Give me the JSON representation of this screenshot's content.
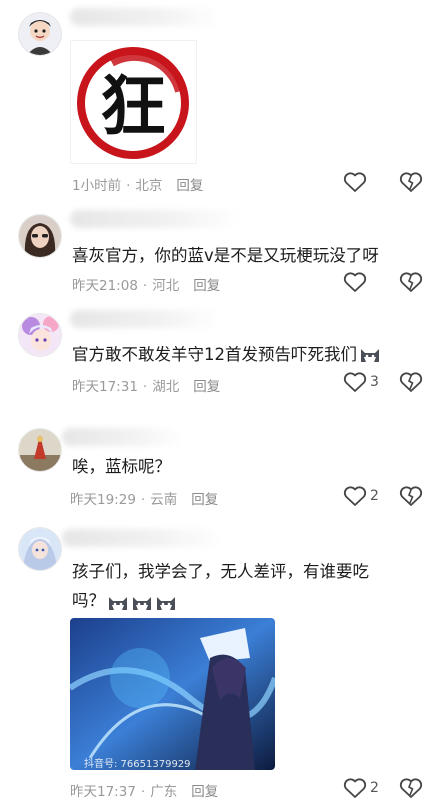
{
  "comments": [
    {
      "text": "",
      "time": "1小时前",
      "location": "北京",
      "reply_label": "回复",
      "likes": "",
      "sticker_char": "狂"
    },
    {
      "text": "喜灰官方，你的蓝v是不是又玩梗玩没了呀",
      "time": "昨天21:08",
      "location": "河北",
      "reply_label": "回复",
      "likes": ""
    },
    {
      "text": "官方敢不敢发羊守12首发预告吓死我们",
      "time": "昨天17:31",
      "location": "湖北",
      "reply_label": "回复",
      "likes": "3"
    },
    {
      "text": "唉，蓝标呢？",
      "time": "昨天19:29",
      "location": "云南",
      "reply_label": "回复",
      "likes": "2"
    },
    {
      "text_line1": "孩子们，我学会了，无人差评，有谁要吃",
      "text_line2": "吗？",
      "time": "昨天17:37",
      "location": "广东",
      "reply_label": "回复",
      "likes": "2",
      "image_watermark": "抖音号: 76651379929"
    }
  ],
  "separator": "·",
  "colors": {
    "text": "#1c1c1c",
    "meta": "#9a9a9a",
    "sticker_red": "#c8141b"
  },
  "icons": [
    "heart-outline-icon",
    "broken-heart-icon",
    "cat-emoji-icon"
  ]
}
